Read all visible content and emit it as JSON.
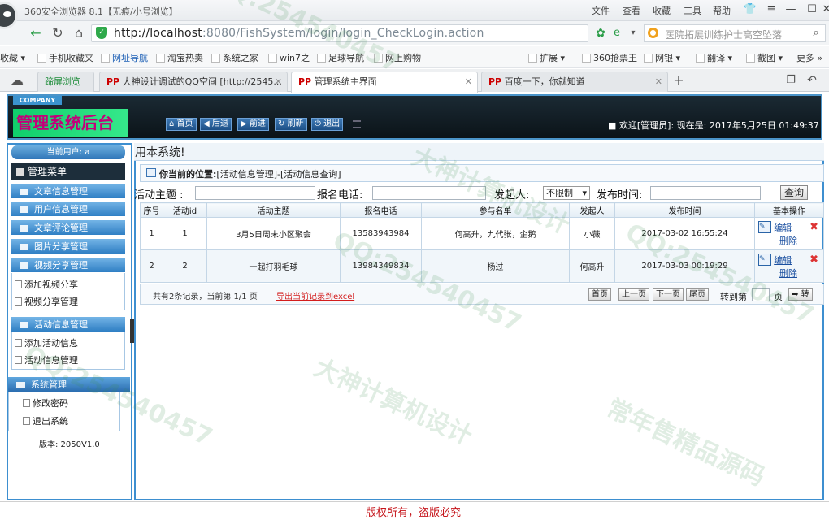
{
  "browser": {
    "window_title": "360安全浏览器 8.1【无痕/小号浏览】",
    "menus": [
      "文件",
      "查看",
      "收藏",
      "工具",
      "帮助"
    ],
    "url_host": "http://localhost",
    "url_rest": ":8080/FishSystem/login/login_CheckLogin.action",
    "search_text": "医院拓展训练护士高空坠落",
    "favorites_left": [
      "收藏",
      "手机收藏夹",
      "网址导航",
      "淘宝热卖",
      "系统之家",
      "win7之",
      "足球导航",
      "网上购物"
    ],
    "favorites_right": [
      "扩展",
      "360抢票王",
      "网银",
      "翻译",
      "截图",
      "更多"
    ],
    "tabs": [
      {
        "label": "蹄屏浏览"
      },
      {
        "label": "大神设计调试的QQ空间 [http://2545..."
      },
      {
        "label": "管理系统主界面"
      },
      {
        "label": "百度一下，你就知道"
      }
    ]
  },
  "header": {
    "company": "COMPANY",
    "title": "管理系统后台",
    "buttons": [
      "首页",
      "后退",
      "前进",
      "刷新",
      "退出"
    ],
    "welcome": "欢迎[管理员]:   现在是: 2017年5月25日  01:49:37"
  },
  "sidebar": {
    "current_user": "当前用户: a",
    "menu_title": "管理菜单",
    "groups": [
      {
        "label": "文章信息管理"
      },
      {
        "label": "用户信息管理"
      },
      {
        "label": "文章评论管理"
      },
      {
        "label": "图片分享管理"
      },
      {
        "label": "视频分享管理",
        "items": [
          "添加视频分享",
          "视频分享管理"
        ]
      },
      {
        "label": "活动信息管理",
        "items": [
          "添加活动信息",
          "活动信息管理"
        ]
      },
      {
        "label": "系统管理",
        "items": [
          "修改密码",
          "退出系统"
        ]
      }
    ],
    "version": "版本: 2050V1.0"
  },
  "main": {
    "welcome_text": "用本系统!",
    "position_label": "你当前的位置:",
    "position_path": "[活动信息管理]-[活动信息查询]",
    "filters": {
      "subject_label": "活动主题 :",
      "phone_label": "报名电话:",
      "initiator_label": "发起人:",
      "initiator_value": "不限制",
      "time_label": "发布时间:",
      "query_button": "查询"
    },
    "table": {
      "headers": [
        "序号",
        "活动id",
        "活动主题",
        "报名电话",
        "参与名单",
        "发起人",
        "发布时间",
        "基本操作"
      ],
      "rows": [
        [
          "1",
          "1",
          "3月5日周末小区聚会",
          "13583943984",
          "何高升，九代张，企鹅",
          "小薇",
          "2017-03-02 16:55:24"
        ],
        [
          "2",
          "2",
          "一起打羽毛球",
          "13984349834",
          "杨过",
          "何高升",
          "2017-03-03 00:19:29"
        ]
      ],
      "edit_label": "编辑",
      "delete_label": "删除"
    },
    "pager": {
      "info": "共有2条记录，当前第 1/1 页",
      "export": "导出当前记录到excel",
      "buttons": [
        "首页",
        "上一页",
        "下一页",
        "尾页"
      ],
      "goto_label": "转到第",
      "page_unit": "页",
      "go_button": "转"
    }
  },
  "footer": {
    "copyright": "版权所有，盗版必究"
  },
  "watermarks": [
    "大神计算机设计",
    "QQ:254540457",
    "常年售精品源码"
  ]
}
